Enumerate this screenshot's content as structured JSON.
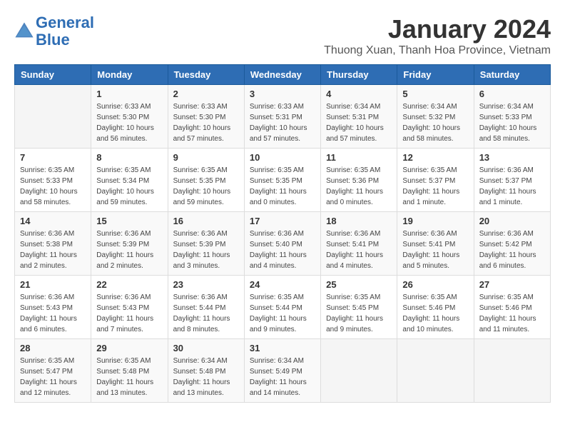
{
  "logo": {
    "line1": "General",
    "line2": "Blue"
  },
  "title": "January 2024",
  "subtitle": "Thuong Xuan, Thanh Hoa Province, Vietnam",
  "weekdays": [
    "Sunday",
    "Monday",
    "Tuesday",
    "Wednesday",
    "Thursday",
    "Friday",
    "Saturday"
  ],
  "weeks": [
    [
      {
        "day": "",
        "sunrise": "",
        "sunset": "",
        "daylight": ""
      },
      {
        "day": "1",
        "sunrise": "Sunrise: 6:33 AM",
        "sunset": "Sunset: 5:30 PM",
        "daylight": "Daylight: 10 hours and 56 minutes."
      },
      {
        "day": "2",
        "sunrise": "Sunrise: 6:33 AM",
        "sunset": "Sunset: 5:30 PM",
        "daylight": "Daylight: 10 hours and 57 minutes."
      },
      {
        "day": "3",
        "sunrise": "Sunrise: 6:33 AM",
        "sunset": "Sunset: 5:31 PM",
        "daylight": "Daylight: 10 hours and 57 minutes."
      },
      {
        "day": "4",
        "sunrise": "Sunrise: 6:34 AM",
        "sunset": "Sunset: 5:31 PM",
        "daylight": "Daylight: 10 hours and 57 minutes."
      },
      {
        "day": "5",
        "sunrise": "Sunrise: 6:34 AM",
        "sunset": "Sunset: 5:32 PM",
        "daylight": "Daylight: 10 hours and 58 minutes."
      },
      {
        "day": "6",
        "sunrise": "Sunrise: 6:34 AM",
        "sunset": "Sunset: 5:33 PM",
        "daylight": "Daylight: 10 hours and 58 minutes."
      }
    ],
    [
      {
        "day": "7",
        "sunrise": "Sunrise: 6:35 AM",
        "sunset": "Sunset: 5:33 PM",
        "daylight": "Daylight: 10 hours and 58 minutes."
      },
      {
        "day": "8",
        "sunrise": "Sunrise: 6:35 AM",
        "sunset": "Sunset: 5:34 PM",
        "daylight": "Daylight: 10 hours and 59 minutes."
      },
      {
        "day": "9",
        "sunrise": "Sunrise: 6:35 AM",
        "sunset": "Sunset: 5:35 PM",
        "daylight": "Daylight: 10 hours and 59 minutes."
      },
      {
        "day": "10",
        "sunrise": "Sunrise: 6:35 AM",
        "sunset": "Sunset: 5:35 PM",
        "daylight": "Daylight: 11 hours and 0 minutes."
      },
      {
        "day": "11",
        "sunrise": "Sunrise: 6:35 AM",
        "sunset": "Sunset: 5:36 PM",
        "daylight": "Daylight: 11 hours and 0 minutes."
      },
      {
        "day": "12",
        "sunrise": "Sunrise: 6:35 AM",
        "sunset": "Sunset: 5:37 PM",
        "daylight": "Daylight: 11 hours and 1 minute."
      },
      {
        "day": "13",
        "sunrise": "Sunrise: 6:36 AM",
        "sunset": "Sunset: 5:37 PM",
        "daylight": "Daylight: 11 hours and 1 minute."
      }
    ],
    [
      {
        "day": "14",
        "sunrise": "Sunrise: 6:36 AM",
        "sunset": "Sunset: 5:38 PM",
        "daylight": "Daylight: 11 hours and 2 minutes."
      },
      {
        "day": "15",
        "sunrise": "Sunrise: 6:36 AM",
        "sunset": "Sunset: 5:39 PM",
        "daylight": "Daylight: 11 hours and 2 minutes."
      },
      {
        "day": "16",
        "sunrise": "Sunrise: 6:36 AM",
        "sunset": "Sunset: 5:39 PM",
        "daylight": "Daylight: 11 hours and 3 minutes."
      },
      {
        "day": "17",
        "sunrise": "Sunrise: 6:36 AM",
        "sunset": "Sunset: 5:40 PM",
        "daylight": "Daylight: 11 hours and 4 minutes."
      },
      {
        "day": "18",
        "sunrise": "Sunrise: 6:36 AM",
        "sunset": "Sunset: 5:41 PM",
        "daylight": "Daylight: 11 hours and 4 minutes."
      },
      {
        "day": "19",
        "sunrise": "Sunrise: 6:36 AM",
        "sunset": "Sunset: 5:41 PM",
        "daylight": "Daylight: 11 hours and 5 minutes."
      },
      {
        "day": "20",
        "sunrise": "Sunrise: 6:36 AM",
        "sunset": "Sunset: 5:42 PM",
        "daylight": "Daylight: 11 hours and 6 minutes."
      }
    ],
    [
      {
        "day": "21",
        "sunrise": "Sunrise: 6:36 AM",
        "sunset": "Sunset: 5:43 PM",
        "daylight": "Daylight: 11 hours and 6 minutes."
      },
      {
        "day": "22",
        "sunrise": "Sunrise: 6:36 AM",
        "sunset": "Sunset: 5:43 PM",
        "daylight": "Daylight: 11 hours and 7 minutes."
      },
      {
        "day": "23",
        "sunrise": "Sunrise: 6:36 AM",
        "sunset": "Sunset: 5:44 PM",
        "daylight": "Daylight: 11 hours and 8 minutes."
      },
      {
        "day": "24",
        "sunrise": "Sunrise: 6:35 AM",
        "sunset": "Sunset: 5:44 PM",
        "daylight": "Daylight: 11 hours and 9 minutes."
      },
      {
        "day": "25",
        "sunrise": "Sunrise: 6:35 AM",
        "sunset": "Sunset: 5:45 PM",
        "daylight": "Daylight: 11 hours and 9 minutes."
      },
      {
        "day": "26",
        "sunrise": "Sunrise: 6:35 AM",
        "sunset": "Sunset: 5:46 PM",
        "daylight": "Daylight: 11 hours and 10 minutes."
      },
      {
        "day": "27",
        "sunrise": "Sunrise: 6:35 AM",
        "sunset": "Sunset: 5:46 PM",
        "daylight": "Daylight: 11 hours and 11 minutes."
      }
    ],
    [
      {
        "day": "28",
        "sunrise": "Sunrise: 6:35 AM",
        "sunset": "Sunset: 5:47 PM",
        "daylight": "Daylight: 11 hours and 12 minutes."
      },
      {
        "day": "29",
        "sunrise": "Sunrise: 6:35 AM",
        "sunset": "Sunset: 5:48 PM",
        "daylight": "Daylight: 11 hours and 13 minutes."
      },
      {
        "day": "30",
        "sunrise": "Sunrise: 6:34 AM",
        "sunset": "Sunset: 5:48 PM",
        "daylight": "Daylight: 11 hours and 13 minutes."
      },
      {
        "day": "31",
        "sunrise": "Sunrise: 6:34 AM",
        "sunset": "Sunset: 5:49 PM",
        "daylight": "Daylight: 11 hours and 14 minutes."
      },
      {
        "day": "",
        "sunrise": "",
        "sunset": "",
        "daylight": ""
      },
      {
        "day": "",
        "sunrise": "",
        "sunset": "",
        "daylight": ""
      },
      {
        "day": "",
        "sunrise": "",
        "sunset": "",
        "daylight": ""
      }
    ]
  ]
}
